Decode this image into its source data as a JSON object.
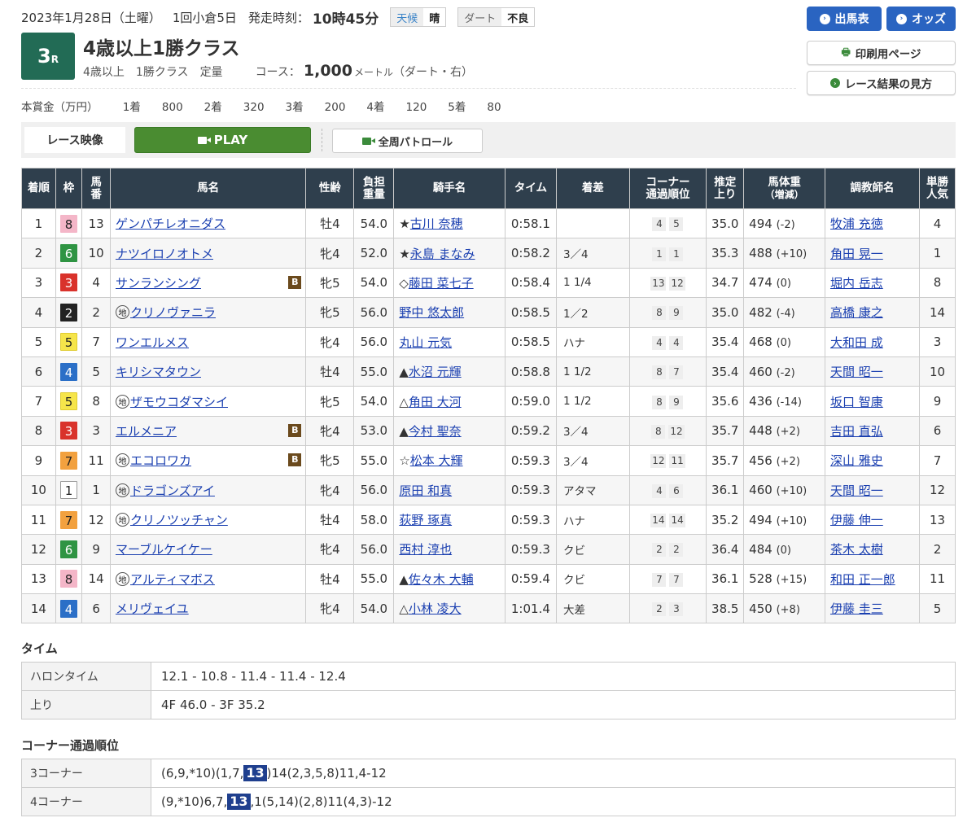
{
  "header": {
    "date": "2023年1月28日（土曜）",
    "meeting": "1回小倉5日",
    "post_time_label": "発走時刻：",
    "post_time": "10時45分",
    "weather_label": "天候",
    "weather": "晴",
    "track_label": "ダート",
    "track_condition": "不良",
    "race_number": "3",
    "race_suffix": "R",
    "race_title": "4歳以上1勝クラス",
    "age_cond": "4歳以上",
    "class_cond": "1勝クラス",
    "weight_cond": "定量",
    "course_label": "コース：",
    "distance": "1,000",
    "distance_unit": "メートル",
    "course_type": "（ダート・右）",
    "prize_label": "本賞金（万円）",
    "prizes": [
      {
        "place": "1着",
        "amount": "800"
      },
      {
        "place": "2着",
        "amount": "320"
      },
      {
        "place": "3着",
        "amount": "200"
      },
      {
        "place": "4着",
        "amount": "120"
      },
      {
        "place": "5着",
        "amount": "80"
      }
    ]
  },
  "nav": {
    "shutsuba": "出馬表",
    "odds": "オッズ",
    "print": "印刷用ページ",
    "howto": "レース結果の見方"
  },
  "video": {
    "label": "レース映像",
    "play": "PLAY",
    "patrol": "全周パトロール"
  },
  "table": {
    "headers": {
      "rank": "着順",
      "waku": "枠",
      "umaban": [
        "馬",
        "番"
      ],
      "name": "馬名",
      "sexage": "性齢",
      "weight": [
        "負担",
        "重量"
      ],
      "jockey": "騎手名",
      "time": "タイム",
      "margin": "着差",
      "corner": [
        "コーナー",
        "通過順位"
      ],
      "agari": [
        "推定",
        "上り"
      ],
      "bodyweight": [
        "馬体重",
        "（増減）"
      ],
      "trainer": "調教師名",
      "pop": [
        "単勝",
        "人気"
      ]
    },
    "rows": [
      {
        "rank": "1",
        "waku": "8",
        "umaban": "13",
        "mark": "",
        "name": "ゲンパチレオニダス",
        "blinker": "",
        "sexage": "牡4",
        "weight": "54.0",
        "jmark": "★",
        "jockey": "古川 奈穂",
        "time": "0:58.1",
        "margin": "",
        "c1": "4",
        "c2": "5",
        "agari": "35.0",
        "bw": "494",
        "bwd": "(-2)",
        "trainer": "牧浦 充徳",
        "pop": "4"
      },
      {
        "rank": "2",
        "waku": "6",
        "umaban": "10",
        "mark": "",
        "name": "ナツイロノオトメ",
        "blinker": "",
        "sexage": "牝4",
        "weight": "52.0",
        "jmark": "★",
        "jockey": "永島 まなみ",
        "time": "0:58.2",
        "margin": "3／4",
        "c1": "1",
        "c2": "1",
        "agari": "35.3",
        "bw": "488",
        "bwd": "(+10)",
        "trainer": "角田 晃一",
        "pop": "1"
      },
      {
        "rank": "3",
        "waku": "3",
        "umaban": "4",
        "mark": "",
        "name": "サンランシング",
        "blinker": "B",
        "sexage": "牝5",
        "weight": "54.0",
        "jmark": "◇",
        "jockey": "藤田 菜七子",
        "time": "0:58.4",
        "margin": "1 1/4",
        "c1": "13",
        "c2": "12",
        "agari": "34.7",
        "bw": "474",
        "bwd": "(0)",
        "trainer": "堀内 岳志",
        "pop": "8"
      },
      {
        "rank": "4",
        "waku": "2",
        "umaban": "2",
        "mark": "地",
        "name": "クリノヴァニラ",
        "blinker": "",
        "sexage": "牝5",
        "weight": "56.0",
        "jmark": "",
        "jockey": "野中 悠太郎",
        "time": "0:58.5",
        "margin": "1／2",
        "c1": "8",
        "c2": "9",
        "agari": "35.0",
        "bw": "482",
        "bwd": "(-4)",
        "trainer": "高橋 康之",
        "pop": "14"
      },
      {
        "rank": "5",
        "waku": "5",
        "umaban": "7",
        "mark": "",
        "name": "ワンエルメス",
        "blinker": "",
        "sexage": "牝4",
        "weight": "56.0",
        "jmark": "",
        "jockey": "丸山 元気",
        "time": "0:58.5",
        "margin": "ハナ",
        "c1": "4",
        "c2": "4",
        "agari": "35.4",
        "bw": "468",
        "bwd": "(0)",
        "trainer": "大和田 成",
        "pop": "3"
      },
      {
        "rank": "6",
        "waku": "4",
        "umaban": "5",
        "mark": "",
        "name": "キリシマタウン",
        "blinker": "",
        "sexage": "牡4",
        "weight": "55.0",
        "jmark": "▲",
        "jockey": "水沼 元輝",
        "time": "0:58.8",
        "margin": "1 1/2",
        "c1": "8",
        "c2": "7",
        "agari": "35.4",
        "bw": "460",
        "bwd": "(-2)",
        "trainer": "天間 昭一",
        "pop": "10"
      },
      {
        "rank": "7",
        "waku": "5",
        "umaban": "8",
        "mark": "地",
        "name": "ザモウコダマシイ",
        "blinker": "",
        "sexage": "牝5",
        "weight": "54.0",
        "jmark": "△",
        "jockey": "角田 大河",
        "time": "0:59.0",
        "margin": "1 1/2",
        "c1": "8",
        "c2": "9",
        "agari": "35.6",
        "bw": "436",
        "bwd": "(-14)",
        "trainer": "坂口 智康",
        "pop": "9"
      },
      {
        "rank": "8",
        "waku": "3",
        "umaban": "3",
        "mark": "",
        "name": "エルメニア",
        "blinker": "B",
        "sexage": "牝4",
        "weight": "53.0",
        "jmark": "▲",
        "jockey": "今村 聖奈",
        "time": "0:59.2",
        "margin": "3／4",
        "c1": "8",
        "c2": "12",
        "agari": "35.7",
        "bw": "448",
        "bwd": "(+2)",
        "trainer": "吉田 直弘",
        "pop": "6"
      },
      {
        "rank": "9",
        "waku": "7",
        "umaban": "11",
        "mark": "地",
        "name": "エコロワカ",
        "blinker": "B",
        "sexage": "牝5",
        "weight": "55.0",
        "jmark": "☆",
        "jockey": "松本 大輝",
        "time": "0:59.3",
        "margin": "3／4",
        "c1": "12",
        "c2": "11",
        "agari": "35.7",
        "bw": "456",
        "bwd": "(+2)",
        "trainer": "深山 雅史",
        "pop": "7"
      },
      {
        "rank": "10",
        "waku": "1",
        "umaban": "1",
        "mark": "地",
        "name": "ドラゴンズアイ",
        "blinker": "",
        "sexage": "牝4",
        "weight": "56.0",
        "jmark": "",
        "jockey": "原田 和真",
        "time": "0:59.3",
        "margin": "アタマ",
        "c1": "4",
        "c2": "6",
        "agari": "36.1",
        "bw": "460",
        "bwd": "(+10)",
        "trainer": "天間 昭一",
        "pop": "12"
      },
      {
        "rank": "11",
        "waku": "7",
        "umaban": "12",
        "mark": "地",
        "name": "クリノツッチャン",
        "blinker": "",
        "sexage": "牡4",
        "weight": "58.0",
        "jmark": "",
        "jockey": "荻野 琢真",
        "time": "0:59.3",
        "margin": "ハナ",
        "c1": "14",
        "c2": "14",
        "agari": "35.2",
        "bw": "494",
        "bwd": "(+10)",
        "trainer": "伊藤 伸一",
        "pop": "13"
      },
      {
        "rank": "12",
        "waku": "6",
        "umaban": "9",
        "mark": "",
        "name": "マーブルケイケー",
        "blinker": "",
        "sexage": "牝4",
        "weight": "56.0",
        "jmark": "",
        "jockey": "西村 淳也",
        "time": "0:59.3",
        "margin": "クビ",
        "c1": "2",
        "c2": "2",
        "agari": "36.4",
        "bw": "484",
        "bwd": "(0)",
        "trainer": "茶木 太樹",
        "pop": "2"
      },
      {
        "rank": "13",
        "waku": "8",
        "umaban": "14",
        "mark": "地",
        "name": "アルティマボス",
        "blinker": "",
        "sexage": "牡4",
        "weight": "55.0",
        "jmark": "▲",
        "jockey": "佐々木 大輔",
        "time": "0:59.4",
        "margin": "クビ",
        "c1": "7",
        "c2": "7",
        "agari": "36.1",
        "bw": "528",
        "bwd": "(+15)",
        "trainer": "和田 正一郎",
        "pop": "11"
      },
      {
        "rank": "14",
        "waku": "4",
        "umaban": "6",
        "mark": "",
        "name": "メリヴェイユ",
        "blinker": "",
        "sexage": "牝4",
        "weight": "54.0",
        "jmark": "△",
        "jockey": "小林 凌大",
        "time": "1:01.4",
        "margin": "大差",
        "c1": "2",
        "c2": "3",
        "agari": "38.5",
        "bw": "450",
        "bwd": "(+8)",
        "trainer": "伊藤 圭三",
        "pop": "5"
      }
    ]
  },
  "waku_colors": {
    "1": {
      "bg": "#ffffff",
      "fg": "#222222",
      "border": "#999999"
    },
    "2": {
      "bg": "#222222",
      "fg": "#ffffff",
      "border": "#222222"
    },
    "3": {
      "bg": "#d9322b",
      "fg": "#ffffff",
      "border": "#d9322b"
    },
    "4": {
      "bg": "#2b6fc7",
      "fg": "#ffffff",
      "border": "#2b6fc7"
    },
    "5": {
      "bg": "#f6e54a",
      "fg": "#222222",
      "border": "#e0cc30"
    },
    "6": {
      "bg": "#2f9443",
      "fg": "#ffffff",
      "border": "#2f9443"
    },
    "7": {
      "bg": "#f2a13f",
      "fg": "#222222",
      "border": "#f2a13f"
    },
    "8": {
      "bg": "#f4b6c8",
      "fg": "#222222",
      "border": "#f4b6c8"
    }
  },
  "times": {
    "title": "タイム",
    "furlong_label": "ハロンタイム",
    "furlong": "12.1 - 10.8 - 11.4 - 11.4 - 12.4",
    "agari_label": "上り",
    "agari": "4F 46.0 - 3F 35.2"
  },
  "corners": {
    "title": "コーナー通過順位",
    "c3_label": "3コーナー",
    "c3_pre": "(6,9,*10)(1,7,",
    "c3_hl": "13",
    "c3_post": ")14(2,3,5,8)11,4-12",
    "c4_label": "4コーナー",
    "c4_pre": "(9,*10)6,7,",
    "c4_hl": "13",
    "c4_post": ",1(5,14)(2,8)11(4,3)-12"
  }
}
